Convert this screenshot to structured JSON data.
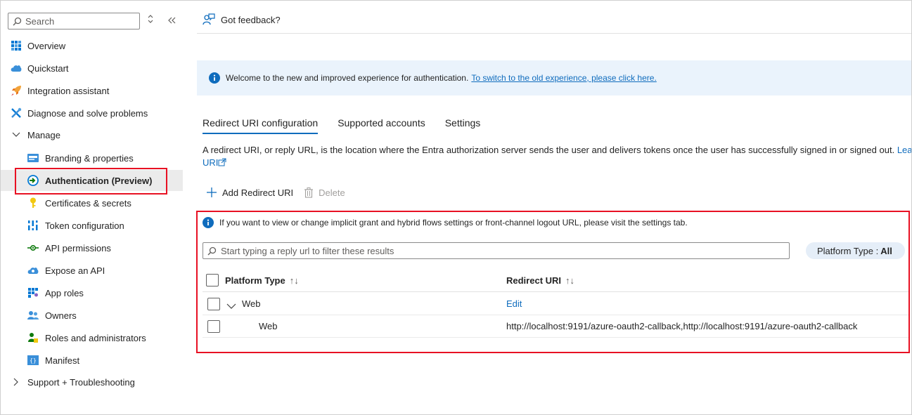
{
  "sidebar": {
    "search_placeholder": "Search",
    "items": [
      {
        "label": "Overview",
        "icon": "overview-grid-icon"
      },
      {
        "label": "Quickstart",
        "icon": "cloud-icon"
      },
      {
        "label": "Integration assistant",
        "icon": "rocket-icon"
      },
      {
        "label": "Diagnose and solve problems",
        "icon": "wrench-icon"
      },
      {
        "label": "Manage",
        "icon": "chevron-down-icon"
      },
      {
        "label": "Branding & properties",
        "icon": "branding-icon"
      },
      {
        "label": "Authentication (Preview)",
        "icon": "authentication-icon"
      },
      {
        "label": "Certificates & secrets",
        "icon": "key-icon"
      },
      {
        "label": "Token configuration",
        "icon": "token-bars-icon"
      },
      {
        "label": "API permissions",
        "icon": "api-permissions-icon"
      },
      {
        "label": "Expose an API",
        "icon": "cloud-api-icon"
      },
      {
        "label": "App roles",
        "icon": "app-roles-icon"
      },
      {
        "label": "Owners",
        "icon": "owners-icon"
      },
      {
        "label": "Roles and administrators",
        "icon": "roles-admin-icon"
      },
      {
        "label": "Manifest",
        "icon": "manifest-icon"
      },
      {
        "label": "Support + Troubleshooting",
        "icon": "chevron-right-icon"
      }
    ]
  },
  "header": {
    "feedback": "Got feedback?"
  },
  "banner": {
    "text": "Welcome to the new and improved experience for authentication.",
    "link": "To switch to the old experience, please click here."
  },
  "tabs": [
    "Redirect URI configuration",
    "Supported accounts",
    "Settings"
  ],
  "description": {
    "text": "A redirect URI, or reply URL, is the location where the Entra authorization server sends the user and delivers tokens once the user has successfully signed in or signed out.",
    "link1": "Learn",
    "link2": "URI"
  },
  "commands": {
    "add": "Add Redirect URI",
    "delete": "Delete"
  },
  "info": "If you want to view or change implicit grant and hybrid flows settings or front-channel logout URL, please visit the settings tab.",
  "filter": {
    "placeholder": "Start typing a reply url to filter these results"
  },
  "platform_pill": {
    "label": "Platform Type :",
    "value": "All"
  },
  "table": {
    "columns": [
      "Platform Type",
      "Redirect URI"
    ],
    "sort_glyph": "↑↓",
    "rows": [
      {
        "platform": "Web",
        "uri": "Edit",
        "group": true
      },
      {
        "platform": "Web",
        "uri": "http://localhost:9191/azure-oauth2-callback,http://localhost:9191/azure-oauth2-callback",
        "group": false
      }
    ]
  },
  "colors": {
    "accent": "#0f6cbd",
    "highlight_border": "#e81123",
    "banner_bg": "#eaf3fc"
  }
}
